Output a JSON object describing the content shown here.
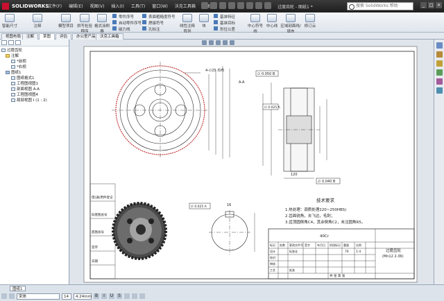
{
  "app": {
    "logo": "SOLIDWORKS",
    "doc_title": "过度齿轮 - 图纸1 *",
    "search_placeholder": "搜索 SolidWorks 帮助"
  },
  "menu": [
    "文件(F)",
    "编辑(E)",
    "视图(V)",
    "插入(I)",
    "工具(T)",
    "窗口(W)",
    "沃克工具箱",
    "帮助(H)"
  ],
  "ribbon": {
    "b1": "智能尺寸",
    "b2": "模型项目",
    "b3": "拼写检验程序",
    "b4": "格式涂刷器",
    "b5": "注释",
    "s1": "零件序号",
    "s2": "自动零件序号",
    "s3": "磁力线",
    "s4": "表面粗糙度符号",
    "s5": "焊接符号",
    "s6": "孔标注",
    "b6": "线性注释阵列",
    "b7": "块",
    "s7": "基准特征",
    "s8": "基准目标",
    "s9": "形位公差",
    "b8": "中心符号线",
    "b9": "中心线",
    "b10": "区域剖面线/填充",
    "b11": "修订云"
  },
  "tabs": [
    "视图布局",
    "注解",
    "草图",
    "评估",
    "办公室产品",
    "沃克工具箱"
  ],
  "tree": [
    {
      "label": "过度齿轮",
      "type": "doc"
    },
    {
      "label": "注解",
      "type": "folder"
    },
    {
      "label": "*前视",
      "type": "plane"
    },
    {
      "label": "*右视",
      "type": "plane"
    },
    {
      "label": "图纸1",
      "type": "sheet"
    },
    {
      "label": "图纸格式1",
      "type": "item"
    },
    {
      "label": "工程图视图1",
      "type": "item"
    },
    {
      "label": "剖面视图 A-A",
      "type": "item"
    },
    {
      "label": "工程图视图4",
      "type": "item"
    },
    {
      "label": "局部视图 I (1 : 2)",
      "type": "item"
    }
  ],
  "status": {
    "sheet_tab": "图纸1",
    "font": "宋体",
    "size": "14",
    "height": "4.24mm"
  },
  "drawing": {
    "section_label": "A-A",
    "dim_top": "∅ 0.050 B",
    "dim_gear_od": "∅ 0.025 A",
    "label_outer": "4-∅25 均布",
    "dim_width": "120",
    "dim_bottom": "∅ 0.040 B",
    "note_title": "技术要求",
    "notes": [
      "1.热处理：调质处理220~250HBS)",
      "2.齿面锐角，去飞边，毛刺；",
      "3.齿顶圆倒角C4，其余倒角C2，未注圆角R5。"
    ],
    "tb_left_rows": [
      "借(通)用件登记",
      "旧底图总号",
      "底图总号",
      "签字",
      "日期"
    ],
    "tb_title": "过度齿轮",
    "tb_code": "(Mn12 2-36)",
    "tb_material": "40Cr",
    "tb_head": [
      "标记",
      "处数",
      "更改文件号",
      "签字",
      "年月日",
      "阶段标记",
      "重量",
      "比例"
    ],
    "tb_roles": [
      "设计",
      "校对",
      "审核",
      "工艺"
    ],
    "tb_std": "标准化",
    "tb_approve": "批准",
    "tb_scale": "1:4",
    "tb_weight": "76",
    "tb_sheets": "共 张 第 张",
    "dim_small": "∅ 0.025 A",
    "dim_key": "16"
  }
}
